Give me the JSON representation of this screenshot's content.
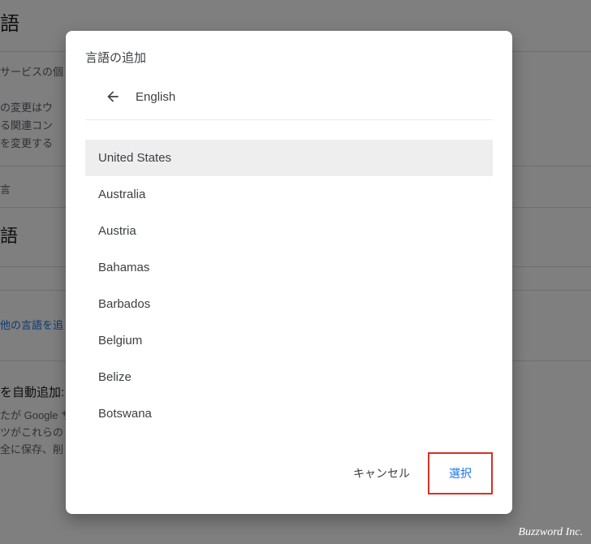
{
  "background": {
    "title": "語",
    "sub": "サービスの個",
    "para1": "の変更はウ",
    "para2": "る関連コン",
    "para3": "を変更する",
    "sec1": "言",
    "sec2": "語",
    "link": "他の言語を追",
    "auto_title": "を自動追加:",
    "auto_desc1": "たが Google サ",
    "auto_desc2": "ツがこれらの",
    "auto_desc3": "全に保存、削"
  },
  "dialog": {
    "title": "言語の追加",
    "header": "English",
    "countries": [
      {
        "name": "United States",
        "selected": true
      },
      {
        "name": "Australia",
        "selected": false
      },
      {
        "name": "Austria",
        "selected": false
      },
      {
        "name": "Bahamas",
        "selected": false
      },
      {
        "name": "Barbados",
        "selected": false
      },
      {
        "name": "Belgium",
        "selected": false
      },
      {
        "name": "Belize",
        "selected": false
      },
      {
        "name": "Botswana",
        "selected": false
      }
    ],
    "cancel_label": "キャンセル",
    "select_label": "選択"
  },
  "attribution": "Buzzword Inc."
}
